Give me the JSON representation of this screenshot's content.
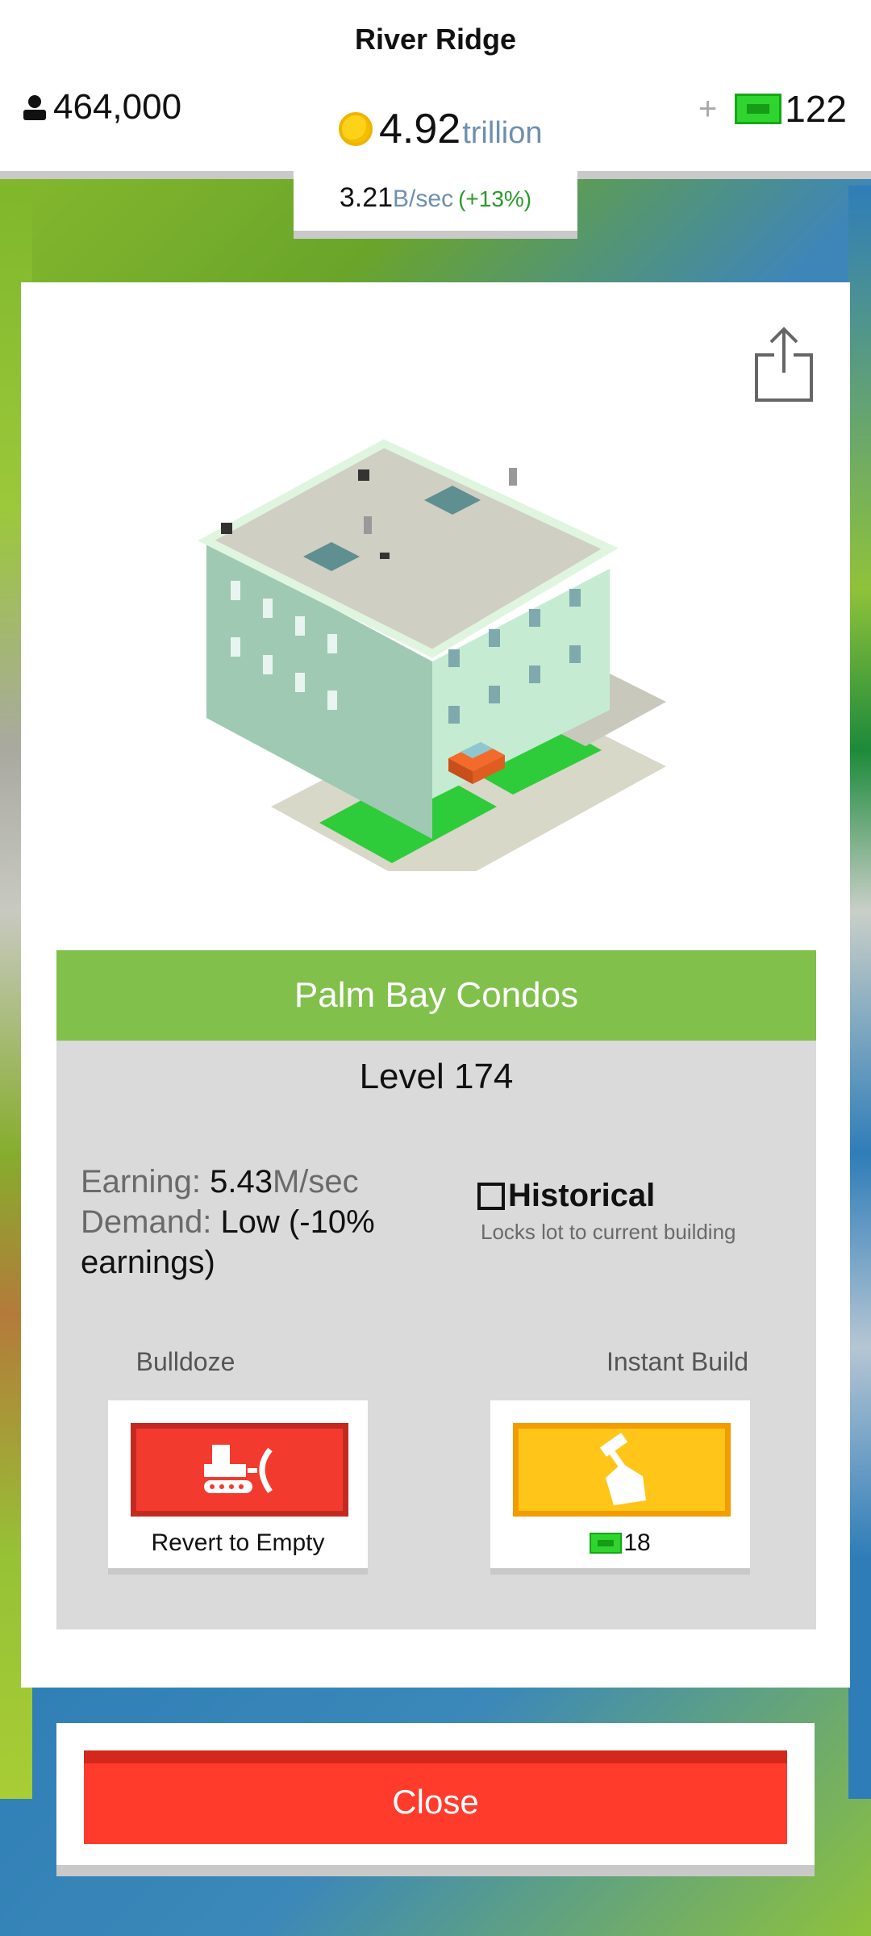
{
  "header": {
    "city_name": "River Ridge",
    "population": "464,000",
    "coins_value": "4.92",
    "coins_unit": "trillion",
    "cash_value": "122",
    "plus_label": "+",
    "rate_value": "3.21",
    "rate_unit": "B/sec",
    "rate_bonus": "(+13%)",
    "icons": [
      "person-icon",
      "coin-icon",
      "cash-icon"
    ]
  },
  "building": {
    "name": "Palm Bay Condos",
    "level": "Level 174",
    "earning_label": "Earning:",
    "earning_value": "5.43",
    "earning_unit": "M/sec",
    "demand_label": "Demand:",
    "demand_value": "Low (-10% earnings)",
    "historical_label": "Historical",
    "historical_checked": false,
    "historical_sub": "Locks lot to current building"
  },
  "actions": {
    "bulldoze_label": "Bulldoze",
    "bulldoze_caption": "Revert to Empty",
    "instant_label": "Instant Build",
    "instant_cost": "18"
  },
  "footer": {
    "close_label": "Close"
  },
  "colors": {
    "title_green": "#80c04b",
    "close_red": "#ff3b2c",
    "bulldoze_red": "#f23b2e",
    "instant_yellow": "#ffc619"
  }
}
